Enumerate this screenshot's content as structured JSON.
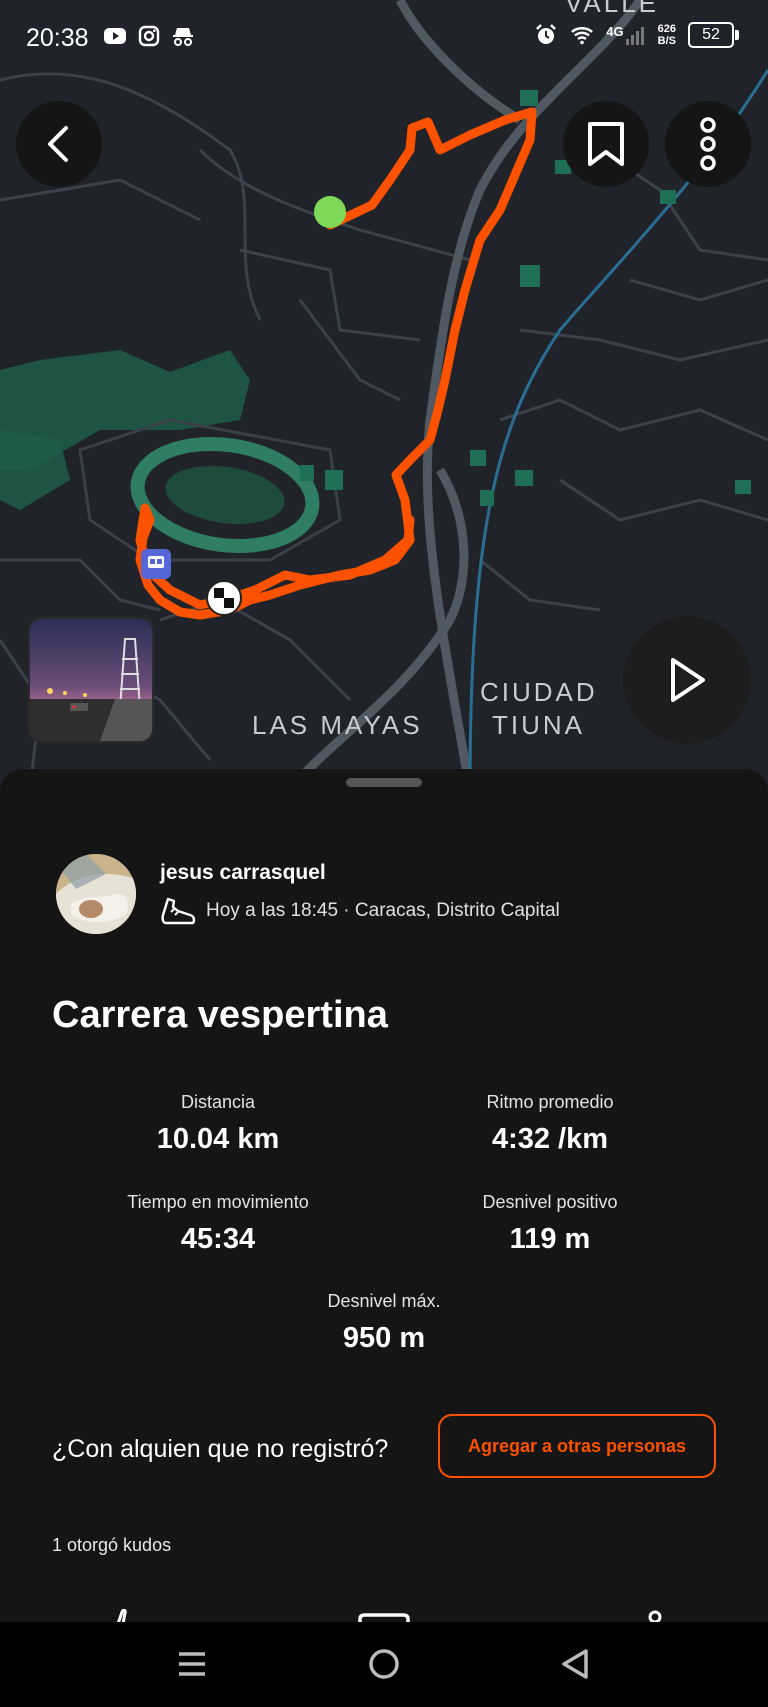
{
  "status_bar": {
    "time": "20:38",
    "network_type": "4G",
    "speed_value": "626",
    "speed_unit": "B/S",
    "battery": "52",
    "icons": [
      "youtube-icon",
      "instagram-icon",
      "incognito-icon",
      "alarm-icon",
      "wifi-icon",
      "signal-icon"
    ]
  },
  "map": {
    "labels": {
      "top": "VALLE",
      "district_1": "LAS MAYAS",
      "district_2_line1": "CIUDAD",
      "district_2_line2": "TIUNA"
    },
    "route_color": "#fc5200",
    "start_color": "#7ed957",
    "buttons": [
      "back-arrow-icon",
      "bookmark-icon",
      "more-vertical-icon",
      "play-icon"
    ]
  },
  "activity": {
    "athlete_name": "jesus carrasquel",
    "meta": "Hoy a las 18:45 · Caracas, Distrito Capital",
    "title": "Carrera vespertina",
    "stats": {
      "distance": {
        "label": "Distancia",
        "value": "10.04 km"
      },
      "pace": {
        "label": "Ritmo promedio",
        "value": "4:32 /km"
      },
      "moving_time": {
        "label": "Tiempo en movimiento",
        "value": "45:34"
      },
      "elevation_gain": {
        "label": "Desnivel positivo",
        "value": "119 m"
      },
      "max_elevation": {
        "label": "Desnivel máx.",
        "value": "950 m"
      }
    },
    "add_people_question": "¿Con alquien que no registró?",
    "add_people_button": "Agregar a otras personas",
    "kudos": "1 otorgó kudos"
  },
  "colors": {
    "accent": "#fc5200",
    "background": "#151515",
    "map_background": "#20242a",
    "park_green": "#1e6f55"
  }
}
